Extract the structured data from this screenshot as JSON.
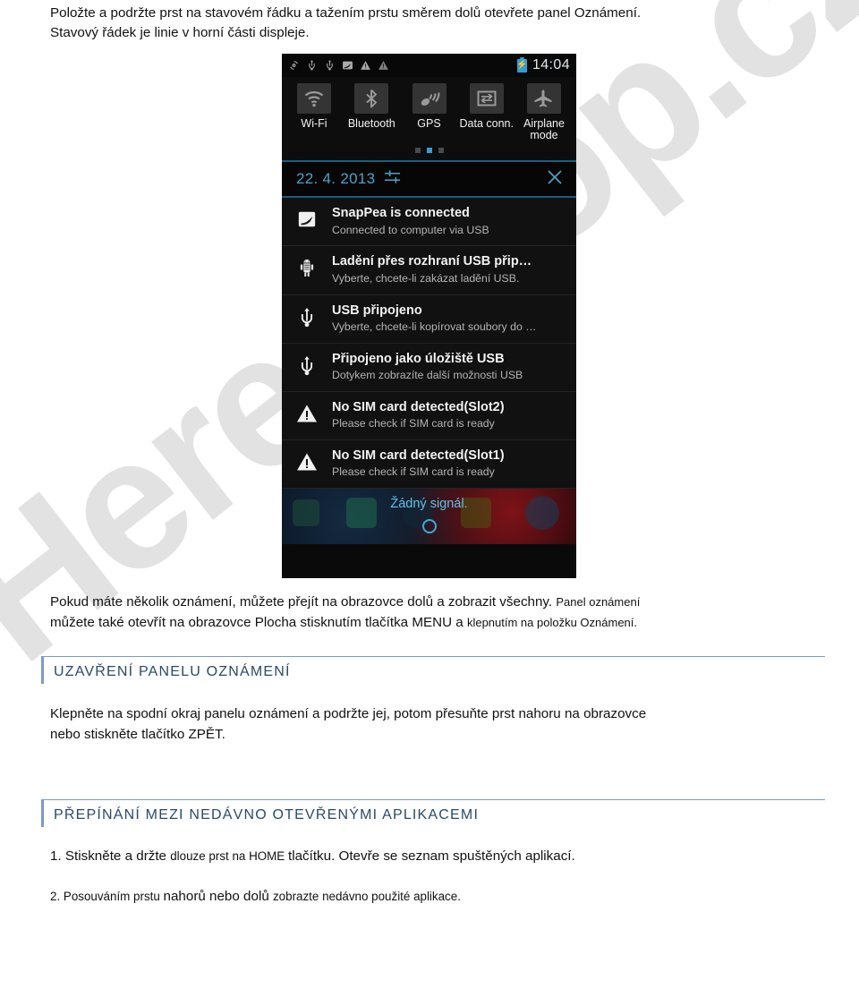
{
  "document": {
    "intro_line1": "Položte a podržte prst na stavovém řádku a tažením prstu směrem dolů otevřete panel Oznámení.",
    "intro_line2": "Stavový řádek je linie v horní části displeje.",
    "para2_part1": "Pokud máte několik oznámení, můžete přejít na obrazovce dolů a zobrazit všechny.",
    "para2_part2": "Panel oznámení",
    "para2_line2_a": "můžete také otevřít na obrazovce Plocha stisknutím tlačítka MENU a ",
    "para2_line2_b": "klepnutím na položku Oznámení.",
    "section1_heading": "UZAVŘENÍ PANELU OZNÁMENÍ",
    "section1_body_line1": "Klepněte na spodní okraj panelu oznámení a podržte jej, potom přesuňte prst nahoru na obrazovce",
    "section1_body_line2": "nebo stiskněte tlačítko ZPĚT.",
    "section2_heading": "PŘEPÍNÁNÍ MEZI NEDÁVNO OTEVŘENÝMI APLIKACEMI",
    "step1_a": "1. Stiskněte a držte ",
    "step1_b": "dlouze prst na HOME ",
    "step1_c": "tlačítku. Otevře se seznam spuštěných aplikací.",
    "step2_a": "2. Posouváním prstu ",
    "step2_b": "nahorů nebo dolů ",
    "step2_c": "zobrazte nedávno použité aplikace.",
    "watermark_text": "Here-shop.cz"
  },
  "phone": {
    "statusbar": {
      "icons": [
        "sync-icon",
        "usb-icon",
        "usb-icon",
        "snappea-icon",
        "warning-icon",
        "warning-icon"
      ],
      "battery_icon": "battery-charging-icon",
      "battery_glyph": "⚡",
      "clock": "14:04"
    },
    "quick_toggles": [
      {
        "label": "Wi-Fi",
        "icon": "wifi-icon"
      },
      {
        "label": "Bluetooth",
        "icon": "bluetooth-icon"
      },
      {
        "label": "GPS",
        "icon": "gps-icon"
      },
      {
        "label": "Data conn.",
        "icon": "data-connection-icon"
      },
      {
        "label": "Airplane mode",
        "icon": "airplane-icon"
      }
    ],
    "page_dots": {
      "count": 3,
      "active_index": 1,
      "active_color": "#2e9fd8"
    },
    "date_bar": {
      "date": "22. 4. 2013",
      "settings_icon": "sliders-icon",
      "close_icon": "close-icon",
      "accent_color": "#4aa3c7"
    },
    "notifications": [
      {
        "icon": "snappea-icon",
        "title": "SnapPea is connected",
        "subtitle": "Connected to computer via USB"
      },
      {
        "icon": "android-debug-icon",
        "title": "Ladění přes rozhraní USB přip…",
        "subtitle": "Vyberte, chcete-li zakázat ladění USB."
      },
      {
        "icon": "usb-icon",
        "title": "USB připojeno",
        "subtitle": "Vyberte, chcete-li kopírovat soubory do …"
      },
      {
        "icon": "usb-icon",
        "title": "Připojeno jako úložiště USB",
        "subtitle": "Dotykem zobrazíte další možnosti USB"
      },
      {
        "icon": "warning-icon",
        "title": "No SIM card detected(Slot2)",
        "subtitle": "Please check if SIM card is ready"
      },
      {
        "icon": "warning-icon",
        "title": "No SIM card detected(Slot1)",
        "subtitle": "Please check if SIM card is ready"
      }
    ],
    "home_peek": {
      "text": "Žádný signál.",
      "handle_icon": "circle-handle-icon"
    }
  }
}
